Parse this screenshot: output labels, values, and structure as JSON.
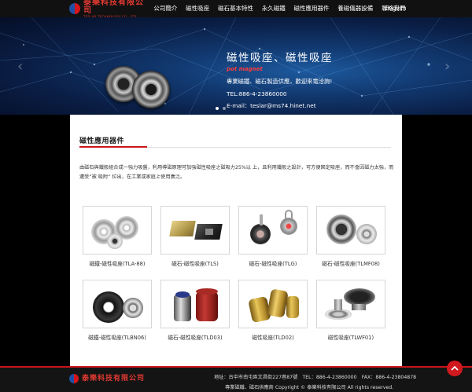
{
  "header": {
    "brand_name": "泰樂科技有限公司",
    "brand_sub": "TESLAR TECHNOLOGY CO., LTD",
    "nav": [
      "公司簡介",
      "磁性吸座",
      "磁石基本特性",
      "永久磁鐵",
      "磁性應用器件",
      "養磁儀器設備",
      "聯絡我們"
    ],
    "lang": "English"
  },
  "hero": {
    "title": "磁性吸座、磁性吸座",
    "subtitle": "pot magnet",
    "line1": "專業磁鐵、磁石製造供應，歡迎來電洽詢!",
    "line2": "TEL:886-4-23860000",
    "line3": "E-mail：teslar@ms74.hinet.net",
    "prev_icon": "chevron-left-icon",
    "next_icon": "chevron-right-icon"
  },
  "section": {
    "title": "磁性應用器件",
    "intro": "由磁石與鐵般組合成一強力吸盤，利用導磁原理可加強磁性吸座之磁吸力25%以 上，且利用鐵般之設計，可方便固定吸座，而不會因磁力太強，而遭受”被 吸附” 拉出，在工業或家庭上使用廣泛。"
  },
  "products": [
    {
      "label": "磁鐵-磁性吸座(TLA-88)"
    },
    {
      "label": "磁石-磁性吸座(TLS)"
    },
    {
      "label": "磁石-磁性吸座(TLG)"
    },
    {
      "label": "磁石-磁性吸座(TLMF08)"
    },
    {
      "label": "磁鐵-磁性吸座(TLBN06)"
    },
    {
      "label": "磁石-磁性吸座(TLD03)"
    },
    {
      "label": "磁性吸座(TLD02)"
    },
    {
      "label": "磁性吸座(TLWF01)"
    }
  ],
  "footer": {
    "brand_name": "泰樂科技有限公司",
    "info": "地址：台中市南屯區文昌街227巷87號　TEL：886-4-23860000　FAX：886-4-23804878",
    "copyright": "專業磁鐵、磁石供應商 Copyright © 泰樂科技有限公司 All rights reserved."
  },
  "colors": {
    "accent": "#c8161d",
    "nav_bg": "#111111",
    "hero_bg": "#123a72"
  }
}
